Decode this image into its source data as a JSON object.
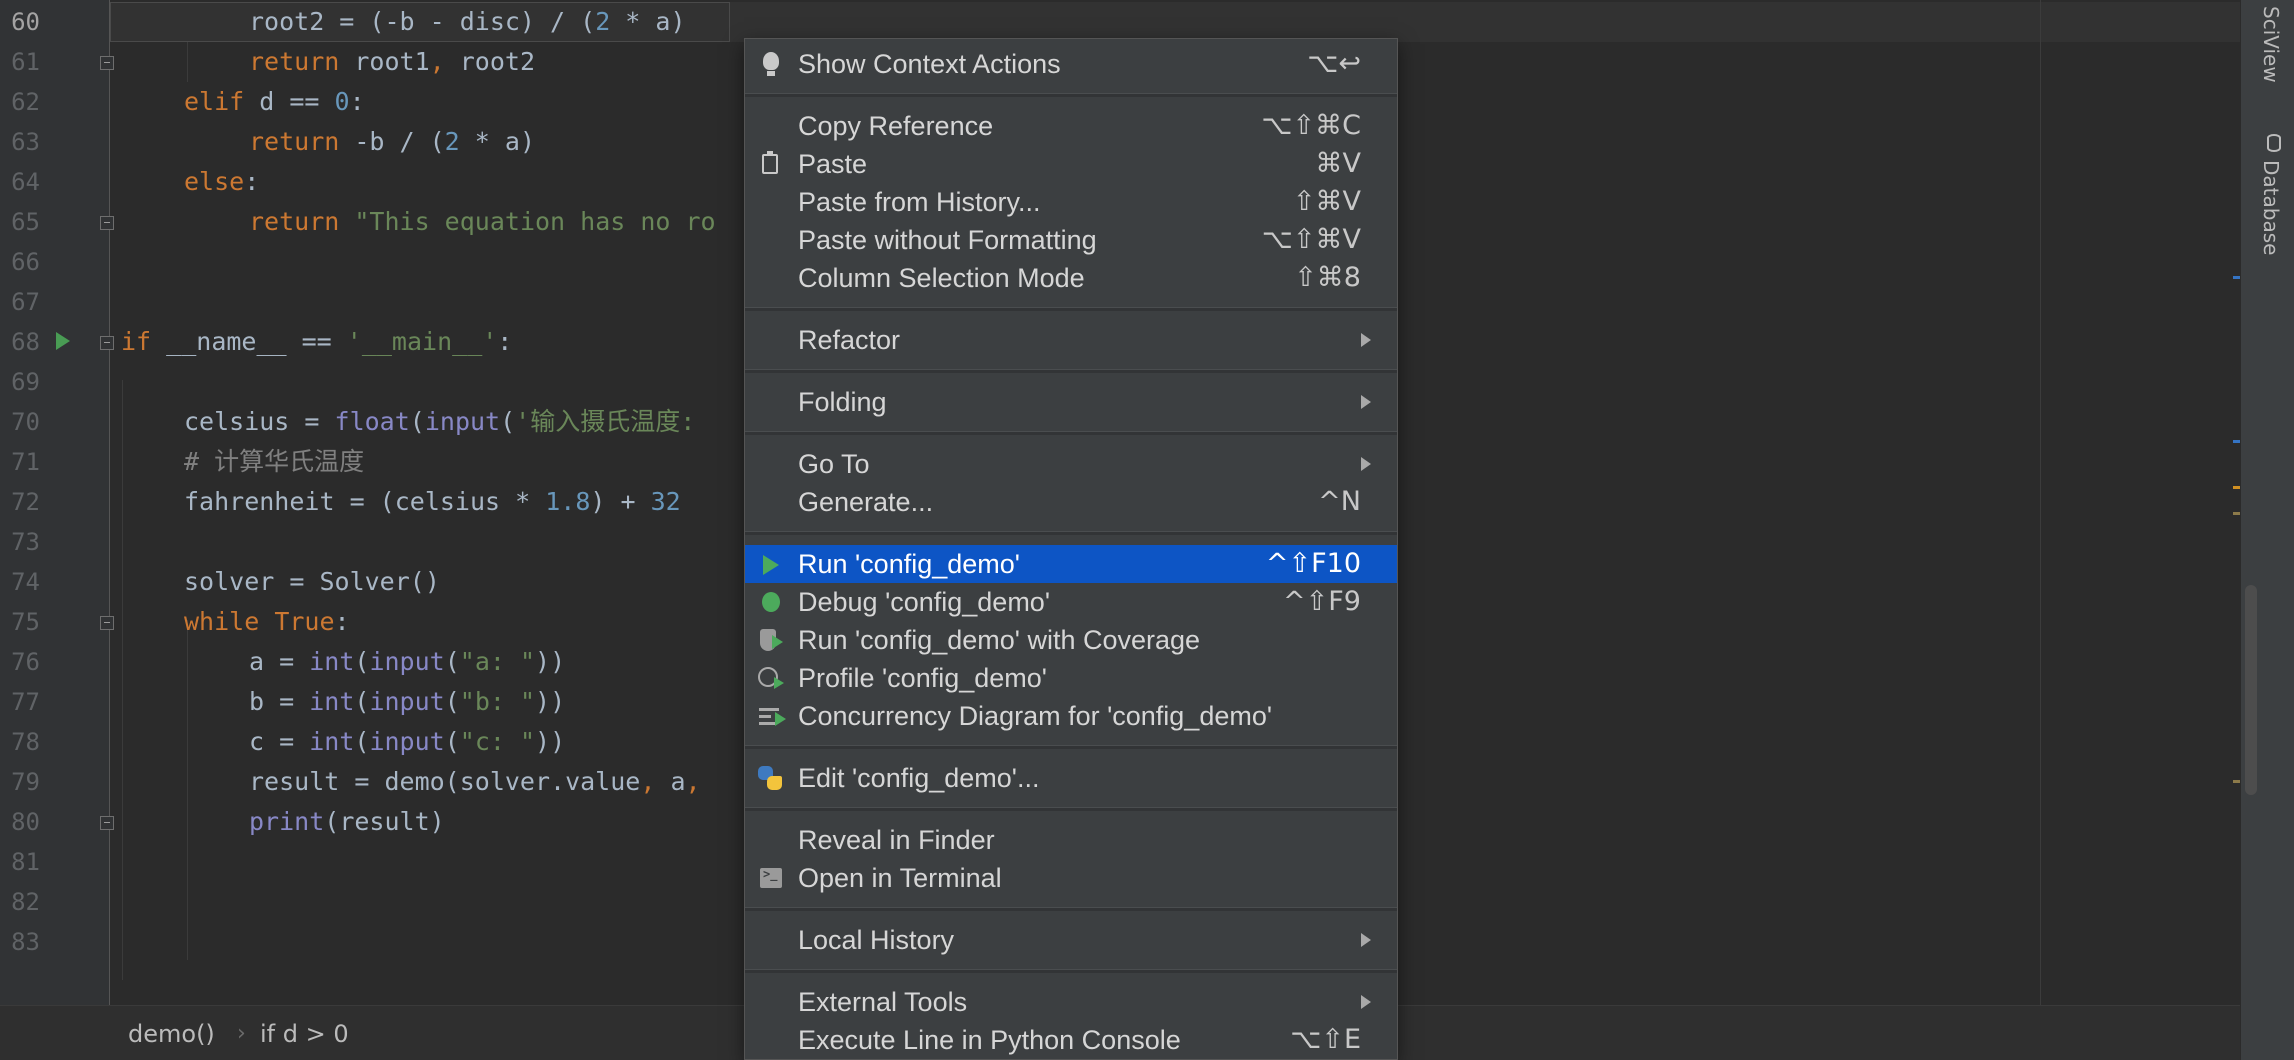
{
  "editor": {
    "line_numbers": [
      "60",
      "61",
      "62",
      "63",
      "64",
      "65",
      "66",
      "67",
      "68",
      "69",
      "70",
      "71",
      "72",
      "73",
      "74",
      "75",
      "76",
      "77",
      "78",
      "79",
      "80",
      "81",
      "82",
      "83"
    ],
    "code": {
      "l60": [
        "root2 = (-b - disc) / (",
        "2",
        " * a)"
      ],
      "l61": [
        "return",
        " root1",
        ",",
        " root2"
      ],
      "l62": [
        "elif",
        " d == ",
        "0",
        ":"
      ],
      "l63": [
        "return",
        " -b / (",
        "2",
        " * a)"
      ],
      "l64": [
        "else",
        ":"
      ],
      "l65": [
        "return",
        " ",
        "\"This equation has no ro"
      ],
      "l68": [
        "if",
        " __name__ == ",
        "'__main__'",
        ":"
      ],
      "l70": [
        "celsius = ",
        "float",
        "(",
        "input",
        "(",
        "'输入摄氏温度:"
      ],
      "l71": [
        "# 计算华氏温度"
      ],
      "l72": [
        "fahrenheit = (celsius * ",
        "1.8",
        ") + ",
        "32"
      ],
      "l74": [
        "solver = Solver()"
      ],
      "l75": [
        "while",
        " ",
        "True",
        ":"
      ],
      "l76": [
        "a = ",
        "int",
        "(",
        "input",
        "(",
        "\"a: \"",
        "))"
      ],
      "l77": [
        "b = ",
        "int",
        "(",
        "input",
        "(",
        "\"b: \"",
        "))"
      ],
      "l78": [
        "c = ",
        "int",
        "(",
        "input",
        "(",
        "\"c: \"",
        "))"
      ],
      "l79": [
        "result = demo(solver.value",
        ",",
        " a",
        ","
      ],
      "l80": [
        "print",
        "(result)"
      ]
    }
  },
  "breadcrumb": {
    "items": [
      "demo()",
      "if d > 0"
    ],
    "separator": "›"
  },
  "tool_strip": {
    "sciview": "SciView",
    "database": "Database"
  },
  "context_menu": {
    "items": [
      {
        "label": "Show Context Actions",
        "shortcut": "⌥↩",
        "icon": "bulb-icon"
      },
      {
        "label": "Copy Reference",
        "shortcut": "⌥⇧⌘C"
      },
      {
        "label": "Paste",
        "shortcut": "⌘V",
        "icon": "clipboard-icon"
      },
      {
        "label": "Paste from History...",
        "shortcut": "⇧⌘V"
      },
      {
        "label": "Paste without Formatting",
        "shortcut": "⌥⇧⌘V"
      },
      {
        "label": "Column Selection Mode",
        "shortcut": "⇧⌘8"
      },
      {
        "label": "Refactor",
        "submenu": true
      },
      {
        "label": "Folding",
        "submenu": true
      },
      {
        "label": "Go To",
        "submenu": true
      },
      {
        "label": "Generate...",
        "shortcut": "^N"
      },
      {
        "label": "Run 'config_demo'",
        "shortcut": "^⇧F10",
        "icon": "run-icon",
        "selected": true
      },
      {
        "label": "Debug 'config_demo'",
        "shortcut": "^⇧F9",
        "icon": "debug-icon"
      },
      {
        "label": "Run 'config_demo' with Coverage",
        "icon": "coverage-icon"
      },
      {
        "label": "Profile 'config_demo'",
        "icon": "profile-icon"
      },
      {
        "label": "Concurrency Diagram for 'config_demo'",
        "icon": "concurrency-icon"
      },
      {
        "label": "Edit 'config_demo'...",
        "icon": "python-icon"
      },
      {
        "label": "Reveal in Finder"
      },
      {
        "label": "Open in Terminal",
        "icon": "terminal-icon"
      },
      {
        "label": "Local History",
        "submenu": true
      },
      {
        "label": "External Tools",
        "submenu": true
      },
      {
        "label": "Execute Line in Python Console",
        "shortcut": "⌥⇧E"
      }
    ]
  },
  "colors": {
    "editor_bg": "#2b2b2b",
    "menu_bg": "#3c3f41",
    "selection": "#0d55c5",
    "keyword": "#cc7832",
    "string": "#6a8759",
    "number": "#6897bb",
    "builtin": "#8888c6"
  }
}
